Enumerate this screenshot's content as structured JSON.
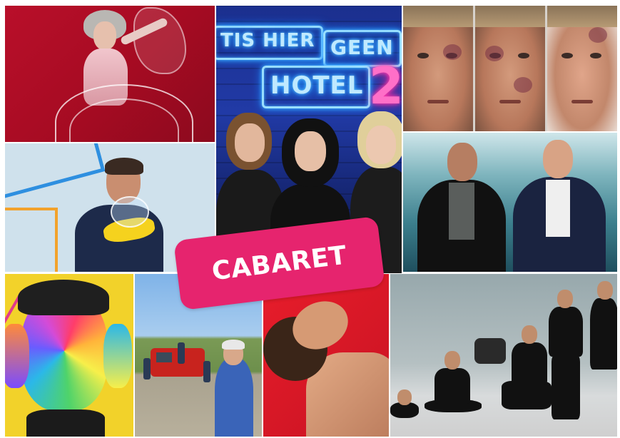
{
  "badge": {
    "label": "CABARET",
    "color": "#e6246e"
  },
  "neon_sign": {
    "line1": "TIS HIER",
    "line2": "GEEN",
    "line3": "HOTEL",
    "number": "2"
  },
  "colors": {
    "neon_blue": "#9be0ff",
    "neon_pink": "#ff6fc8",
    "tile_red": "#c81322",
    "tile_yellow": "#f2d22a"
  }
}
